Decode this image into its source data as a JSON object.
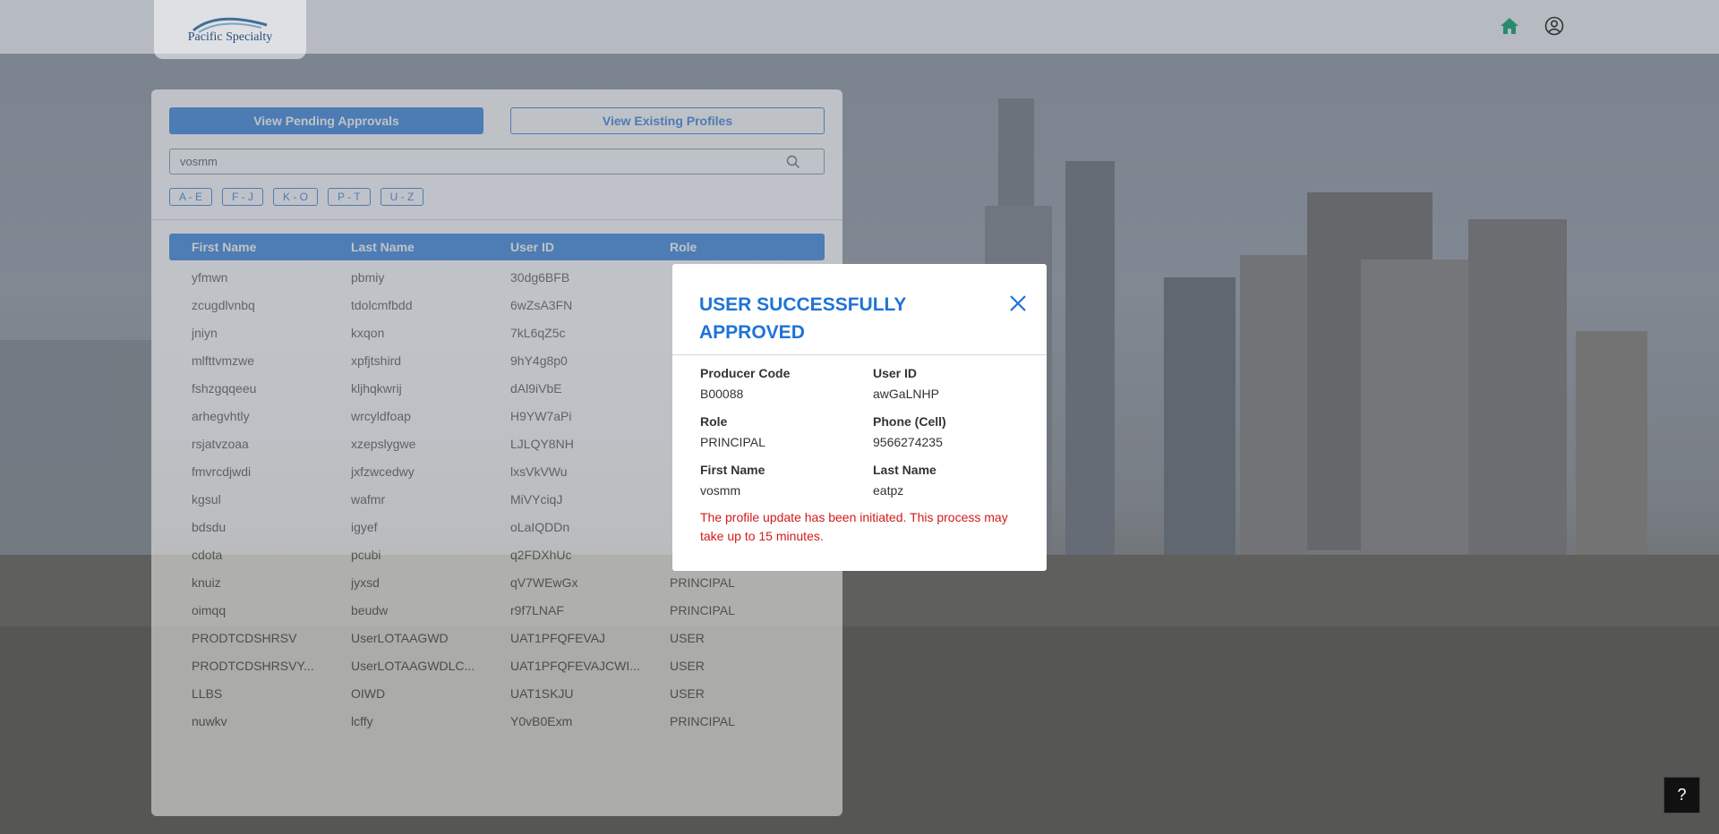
{
  "header": {
    "logo_text": "Pacific Specialty",
    "home_icon": "home-icon",
    "account_icon": "user-circle-icon"
  },
  "panel": {
    "tabs": [
      {
        "label": "View Pending Approvals",
        "active": true
      },
      {
        "label": "View Existing Profiles",
        "active": false
      }
    ],
    "search": {
      "value": "vosmm",
      "icon": "search-icon"
    },
    "alpha_filters": [
      "A - E",
      "F - J",
      "K - O",
      "P - T",
      "U - Z"
    ],
    "table": {
      "headers": [
        "First Name",
        "Last Name",
        "User ID",
        "Role"
      ],
      "rows": [
        [
          "yfmwn",
          "pbmiy",
          "30dg6BFB",
          ""
        ],
        [
          "zcugdlvnbq",
          "tdolcmfbdd",
          "6wZsA3FN",
          ""
        ],
        [
          "jniyn",
          "kxqon",
          "7kL6qZ5c",
          ""
        ],
        [
          "mlfttvmzwe",
          "xpfjtshird",
          "9hY4g8p0",
          ""
        ],
        [
          "fshzgqqeeu",
          "kljhqkwrij",
          "dAl9iVbE",
          ""
        ],
        [
          "arhegvhtly",
          "wrcyldfoap",
          "H9YW7aPi",
          ""
        ],
        [
          "rsjatvzoaa",
          "xzepslygwe",
          "LJLQY8NH",
          ""
        ],
        [
          "fmvrcdjwdi",
          "jxfzwcedwy",
          "lxsVkVWu",
          ""
        ],
        [
          "kgsul",
          "wafmr",
          "MiVYciqJ",
          ""
        ],
        [
          "bdsdu",
          "igyef",
          "oLaIQDDn",
          ""
        ],
        [
          "cdota",
          "pcubi",
          "q2FDXhUc",
          ""
        ],
        [
          "knuiz",
          "jyxsd",
          "qV7WEwGx",
          "PRINCIPAL"
        ],
        [
          "oimqq",
          "beudw",
          "r9f7LNAF",
          "PRINCIPAL"
        ],
        [
          "PRODTCDSHRSV",
          "UserLOTAAGWD",
          "UAT1PFQFEVAJ",
          "USER"
        ],
        [
          "PRODTCDSHRSVY...",
          "UserLOTAAGWDLC...",
          "UAT1PFQFEVAJCWI...",
          "USER"
        ],
        [
          "LLBS",
          "OIWD",
          "UAT1SKJU",
          "USER"
        ],
        [
          "nuwkv",
          "lcffy",
          "Y0vB0Exm",
          "PRINCIPAL"
        ]
      ]
    }
  },
  "modal": {
    "title": "USER SUCCESSFULLY APPROVED",
    "close_icon": "close-icon",
    "fields": [
      {
        "label": "Producer Code",
        "value": "B00088"
      },
      {
        "label": "User ID",
        "value": "awGaLNHP"
      },
      {
        "label": "Role",
        "value": "PRINCIPAL"
      },
      {
        "label": "Phone (Cell)",
        "value": "9566274235"
      },
      {
        "label": "First Name",
        "value": "vosmm"
      },
      {
        "label": "Last Name",
        "value": "eatpz"
      }
    ],
    "notice": "The profile update has been initiated. This process may take up to 15 minutes.",
    "notice_color": "#d31a1a"
  },
  "help_button": {
    "label": "?"
  },
  "colors": {
    "accent": "#1f73d6",
    "overlay": "rgba(70,74,84,0.55)"
  }
}
